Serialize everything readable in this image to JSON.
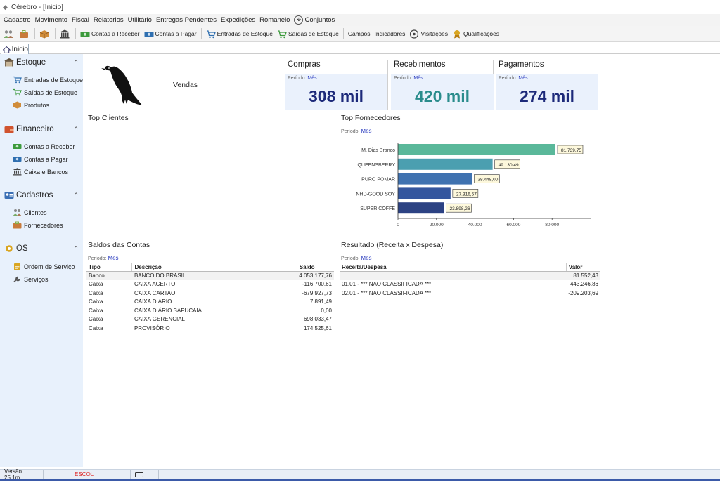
{
  "window": {
    "title": "Cérebro - [Inicio]"
  },
  "menu": [
    "Cadastro",
    "Movimento",
    "Fiscal",
    "Relatorios",
    "Utilitário",
    "Entregas Pendentes",
    "Expedições",
    "Romaneio",
    "Conjuntos"
  ],
  "toolbar": {
    "contas_receber": "Contas a Receber",
    "contas_pagar": "Contas a Pagar",
    "entradas_estoque": "Entradas de Estoque",
    "saidas_estoque": "Saídas de Estoque",
    "campos": "Campos",
    "indicadores": "Indicadores",
    "visitacoes": "Visitações",
    "qualificacoes": "Qualificações"
  },
  "tab": {
    "label": "Inicio"
  },
  "sidebar": {
    "groups": [
      {
        "title": "Estoque",
        "items": [
          "Entradas de Estoque",
          "Saídas de Estoque",
          "Produtos"
        ]
      },
      {
        "title": "Financeiro",
        "items": [
          "Contas a Receber",
          "Contas a Pagar",
          "Caixa e Bancos"
        ]
      },
      {
        "title": "Cadastros",
        "items": [
          "Clientes",
          "Fornecedores"
        ]
      },
      {
        "title": "OS",
        "items": [
          "Ordem de Serviço",
          "Serviços"
        ]
      }
    ]
  },
  "dashboard": {
    "vendas_label": "Vendas",
    "periodo_label": "Período:",
    "periodo_value": "Mês",
    "kpis": [
      {
        "title": "Compras",
        "value": "308 mil",
        "color": "#1d2a7a"
      },
      {
        "title": "Recebimentos",
        "value": "420 mil",
        "color": "#2a8c8c"
      },
      {
        "title": "Pagamentos",
        "value": "274 mil",
        "color": "#1d2a7a"
      }
    ],
    "top_clientes_title": "Top Clientes",
    "top_fornecedores_title": "Top Fornecedores",
    "saldos_title": "Saldos das Contas",
    "resultado_title": "Resultado (Receita x Despesa)"
  },
  "chart_data": {
    "type": "bar",
    "orientation": "horizontal",
    "categories": [
      "M. Dias Branco",
      "QUEENSBERRY",
      "PURO POMAR",
      "NHD-GOOD SOY",
      "SUPER COFFE"
    ],
    "values": [
      81739.75,
      49130.49,
      38448.0,
      27316.57,
      23898.26
    ],
    "data_labels": [
      "81.739,75",
      "49.130,49",
      "38.448,00",
      "27.316,57",
      "23.898,26"
    ],
    "colors": [
      "#5ab89a",
      "#4b9fb0",
      "#3f72b0",
      "#34569e",
      "#2c4283"
    ],
    "xticks": [
      "0",
      "20.000",
      "40.000",
      "60.000",
      "80.000"
    ],
    "tick_values": [
      0,
      20000,
      40000,
      60000,
      80000
    ],
    "xlim": [
      0,
      100000
    ]
  },
  "saldos": {
    "headers": [
      "Tipo",
      "Descrição",
      "Saldo"
    ],
    "rows": [
      [
        "Banco",
        "BANCO DO BRASIL",
        "4.053.177,76"
      ],
      [
        "Caixa",
        "CAIXA ACERTO",
        "-116.700,61"
      ],
      [
        "Caixa",
        "CAIXA CARTAO",
        "-679.927,73"
      ],
      [
        "Caixa",
        "CAIXA DIARIO",
        "7.891,49"
      ],
      [
        "Caixa",
        "CAIXA DIÁRIO SAPUCAIA",
        "0,00"
      ],
      [
        "Caixa",
        "CAIXA GERENCIAL",
        "698.033,47"
      ],
      [
        "Caixa",
        "PROVISÓRIO",
        "174.525,61"
      ]
    ]
  },
  "resultado": {
    "headers": [
      "Receita/Despesa",
      "Valor"
    ],
    "rows": [
      [
        "",
        "81.552,43"
      ],
      [
        "01.01 - *** NAO CLASSIFICADA ***",
        "443.246,86"
      ],
      [
        "02.01 - *** NAO CLASSIFICADA ***",
        "-209.203,69"
      ]
    ]
  },
  "status": {
    "version": "Versão 25.1m",
    "company": "ESCOL"
  }
}
